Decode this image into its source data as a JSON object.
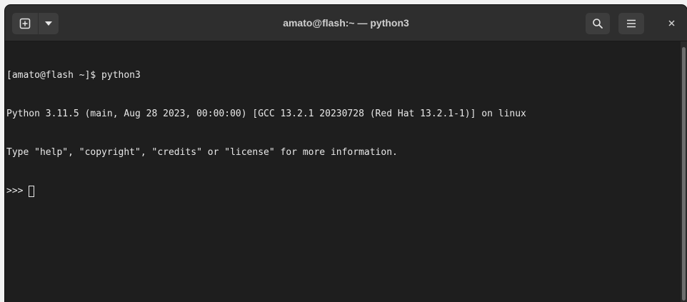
{
  "window": {
    "title": "amato@flash:~ — python3"
  },
  "headerbar": {
    "new_tab_icon": "plus-square-icon",
    "dropdown_icon": "chevron-down-icon",
    "search_icon": "search-icon",
    "menu_icon": "hamburger-menu-icon",
    "close_icon": "close-icon"
  },
  "terminal": {
    "lines": [
      "[amato@flash ~]$ python3",
      "Python 3.11.5 (main, Aug 28 2023, 00:00:00) [GCC 13.2.1 20230728 (Red Hat 13.2.1-1)] on linux",
      "Type \"help\", \"copyright\", \"credits\" or \"license\" for more information."
    ],
    "prompt": ">>> "
  },
  "colors": {
    "background": "#1e1e1e",
    "headerbar": "#2e2e2e",
    "text": "#e8e8e8"
  }
}
